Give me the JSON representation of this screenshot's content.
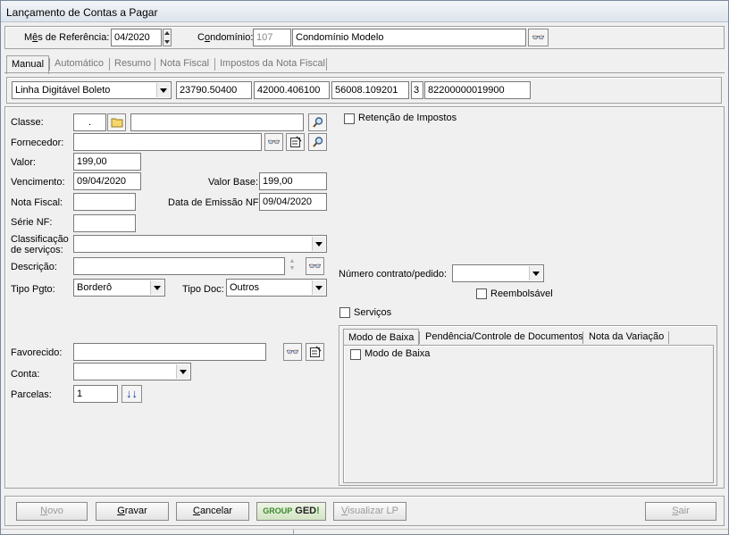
{
  "window": {
    "title": "Lançamento de Contas a Pagar"
  },
  "header": {
    "mes_ref_label_pre": "M",
    "mes_ref_label_ul": "ê",
    "mes_ref_label_post": "s de Referência:",
    "mes_ref_value": "04/2020",
    "condominio_label_pre": "C",
    "condominio_label_ul": "o",
    "condominio_label_post": "ndomínio:",
    "condominio_code": "107",
    "condominio_name": "Condomínio Modelo"
  },
  "tabs": [
    "Manual",
    "Automático",
    "Resumo",
    "Nota Fiscal",
    "Impostos da Nota Fiscal"
  ],
  "boleto": {
    "type": "Linha Digitável Boleto",
    "fields": [
      "23790.50400",
      "42000.406100",
      "56008.109201",
      "3",
      "82200000019900"
    ]
  },
  "form": {
    "classe_label": "Classe:",
    "classe_code": ".",
    "fornecedor_label": "Fornecedor:",
    "valor_label": "Valor:",
    "valor": "199,00",
    "vencimento_label": "Vencimento:",
    "vencimento": "09/04/2020",
    "valor_base_label": "Valor Base:",
    "valor_base": "199,00",
    "nota_fiscal_label": "Nota Fiscal:",
    "data_emissao_label": "Data de Emissão NF:",
    "data_emissao": "09/04/2020",
    "serie_label": "Série NF:",
    "classificacao_label_1": "Classificação",
    "classificacao_label_2": "de serviços:",
    "descricao_label": "Descrição:",
    "tipo_pgto_label": "Tipo Pgto:",
    "tipo_pgto": "Borderô",
    "tipo_doc_label": "Tipo Doc:",
    "tipo_doc": "Outros",
    "favorecido_label": "Favorecido:",
    "conta_label": "Conta:",
    "parcelas_label": "Parcelas:",
    "parcelas": "1"
  },
  "right": {
    "retencao_label": "Retenção de Impostos",
    "numero_contrato_label": "Número contrato/pedido:",
    "reembolsavel_label": "Reembolsável",
    "servicos_label": "Serviços",
    "subtabs": [
      "Modo de Baixa",
      "Pendência/Controle de Documentos",
      "Nota da Variação"
    ],
    "modo_baixa_label": "Modo de Baixa"
  },
  "buttons": {
    "novo_pre": "",
    "novo_ul": "N",
    "novo_post": "ovo",
    "gravar_pre": "",
    "gravar_ul": "G",
    "gravar_post": "ravar",
    "cancelar_pre": "",
    "cancelar_ul": "C",
    "cancelar_post": "ancelar",
    "group_ged_1": "GROUP",
    "group_ged_2": "GED",
    "visualizar_pre": "",
    "visualizar_ul": "V",
    "visualizar_post": "isualizar LP",
    "sair_pre": "",
    "sair_ul": "S",
    "sair_post": "air"
  },
  "colors": {
    "ged_green": "#3a8a2a",
    "ged_bg": "#d8e8c8"
  }
}
